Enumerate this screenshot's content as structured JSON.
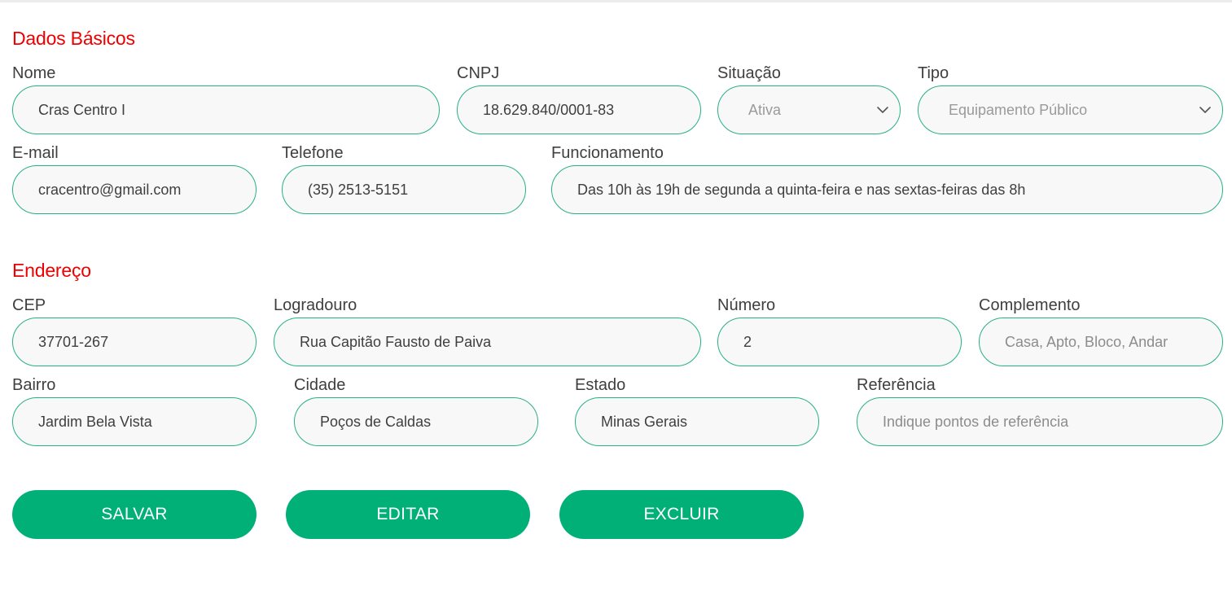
{
  "sections": {
    "basic": "Dados Básicos",
    "address": "Endereço"
  },
  "basic": {
    "nome": {
      "label": "Nome",
      "value": "Cras Centro I"
    },
    "cnpj": {
      "label": "CNPJ",
      "value": "18.629.840/0001-83"
    },
    "situacao": {
      "label": "Situação",
      "selected": "Ativa"
    },
    "tipo": {
      "label": "Tipo",
      "selected": "Equipamento Público"
    },
    "email": {
      "label": "E-mail",
      "value": "cracentro@gmail.com"
    },
    "telefone": {
      "label": "Telefone",
      "value": "(35) 2513-5151"
    },
    "funcionamento": {
      "label": "Funcionamento",
      "value": "Das 10h às 19h de segunda a quinta-feira e nas sextas-feiras das 8h"
    }
  },
  "address": {
    "cep": {
      "label": "CEP",
      "value": "37701-267"
    },
    "logradouro": {
      "label": "Logradouro",
      "value": "Rua Capitão Fausto de Paiva"
    },
    "numero": {
      "label": "Número",
      "value": "2"
    },
    "complemento": {
      "label": "Complemento",
      "placeholder": "Casa, Apto, Bloco, Andar"
    },
    "bairro": {
      "label": "Bairro",
      "value": "Jardim Bela Vista"
    },
    "cidade": {
      "label": "Cidade",
      "value": "Poços de Caldas"
    },
    "estado": {
      "label": "Estado",
      "value": "Minas Gerais"
    },
    "referencia": {
      "label": "Referência",
      "placeholder": "Indique pontos de referência"
    }
  },
  "actions": {
    "save": "SALVAR",
    "edit": "EDITAR",
    "delete": "EXCLUIR"
  },
  "icons": {
    "select": "chevron-down-icon"
  },
  "colors": {
    "section_title": "#ee0000",
    "field_border": "#27b08a",
    "button": "#00b077",
    "field_bg": "#f8f8f8"
  }
}
